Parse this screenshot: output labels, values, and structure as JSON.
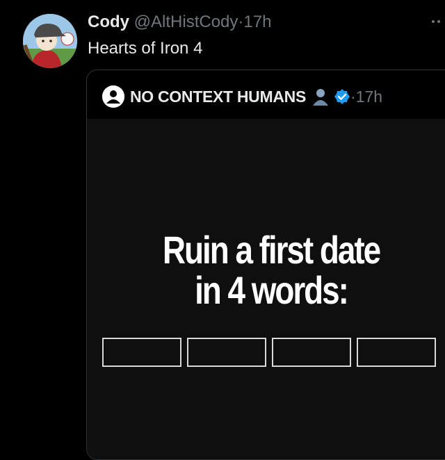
{
  "tweet": {
    "author_name": "Cody",
    "handle": "@AltHistCody",
    "separator": "·",
    "time": "17h",
    "text": "Hearts of Iron 4"
  },
  "quote": {
    "author_name": "NO CONTEXT HUMANS",
    "separator": "·",
    "time": "17h",
    "headline_line1": "Ruin a first date",
    "headline_line2": "in 4 words:",
    "word_box_count": 4
  },
  "icons": {
    "avatar": "cartoon-avatar-icon",
    "quote_avatar": "anonymous-person-icon",
    "bust": "bust-silhouette-icon",
    "verified": "verified-badge-icon",
    "more": "more-dots-icon"
  },
  "colors": {
    "background": "#000000",
    "text_primary": "#e7e9ea",
    "text_secondary": "#71767b",
    "verified_blue": "#1d9bf0",
    "border": "#2f3336"
  }
}
